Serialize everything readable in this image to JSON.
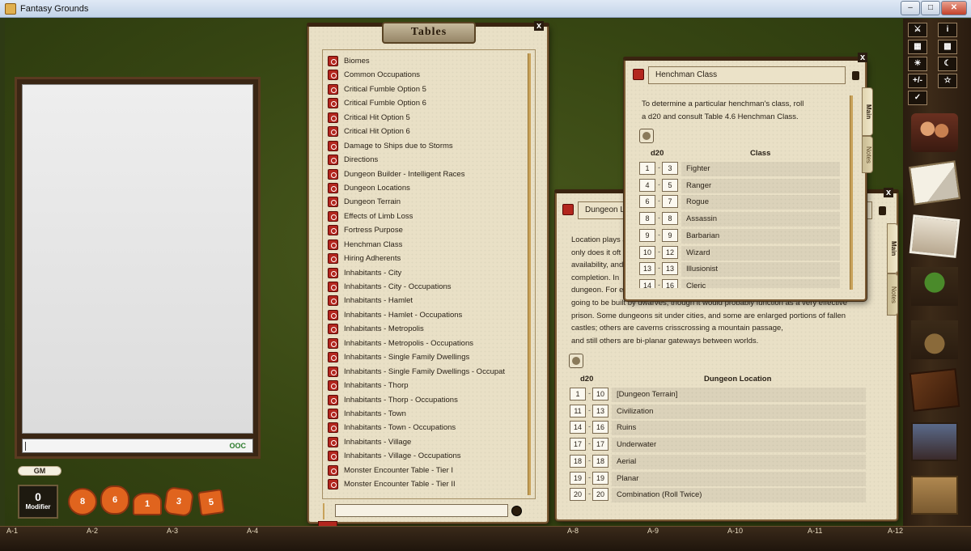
{
  "window": {
    "title": "Fantasy Grounds"
  },
  "chat": {
    "entry_value": "",
    "ooc_label": "OOC"
  },
  "identity": {
    "gm_label": "GM"
  },
  "modifier": {
    "value": "0",
    "label": "Modifier"
  },
  "dice": [
    "d20",
    "d12",
    "d10",
    "d8",
    "d6",
    "d4"
  ],
  "dice_faces": {
    "d20": "8",
    "d12": "6",
    "d10": "1",
    "d8": "3",
    "d6": "5"
  },
  "tables_window": {
    "title": "Tables",
    "close_label": "x",
    "items": [
      "Biomes",
      "Common Occupations",
      "Critical Fumble Option 5",
      "Critical Fumble Option 6",
      "Critical Hit Option 5",
      "Critical Hit Option 6",
      "Damage to Ships due to Storms",
      "Directions",
      "Dungeon Builder - Intelligent Races",
      "Dungeon Locations",
      "Dungeon Terrain",
      "Effects of Limb Loss",
      "Fortress Purpose",
      "Henchman Class",
      "Hiring Adherents",
      "Inhabitants - City",
      "Inhabitants - City - Occupations",
      "Inhabitants - Hamlet",
      "Inhabitants - Hamlet - Occupations",
      "Inhabitants - Metropolis",
      "Inhabitants - Metropolis - Occupations",
      "Inhabitants - Single Family Dwellings",
      "Inhabitants - Single Family Dwellings - Occupat",
      "Inhabitants - Thorp",
      "Inhabitants - Thorp - Occupations",
      "Inhabitants - Town",
      "Inhabitants - Town - Occupations",
      "Inhabitants - Village",
      "Inhabitants - Village - Occupations",
      "Monster Encounter Table - Tier I",
      "Monster Encounter Table - Tier II"
    ],
    "filter_value": ""
  },
  "henchman_window": {
    "name": "Henchman Class",
    "close_label": "x",
    "tabs": [
      "Main",
      "Notes"
    ],
    "description": "To determine a particular henchman's class, roll a d20 and consult Table 4.6 Henchman Class.",
    "col_dice": "d20",
    "col_result": "Class",
    "rows": [
      {
        "from": "1",
        "to": "3",
        "result": "Fighter"
      },
      {
        "from": "4",
        "to": "5",
        "result": "Ranger"
      },
      {
        "from": "6",
        "to": "7",
        "result": "Rogue"
      },
      {
        "from": "8",
        "to": "8",
        "result": "Assassin"
      },
      {
        "from": "9",
        "to": "9",
        "result": "Barbarian"
      },
      {
        "from": "10",
        "to": "12",
        "result": "Wizard"
      },
      {
        "from": "13",
        "to": "13",
        "result": "Illusionist"
      },
      {
        "from": "14",
        "to": "16",
        "result": "Cleric"
      }
    ]
  },
  "dungeon_window": {
    "name": "Dungeon Lo",
    "close_label": "x",
    "tabs": [
      "Main",
      "Notes"
    ],
    "desc_lines": [
      "Location plays a",
      "only does it oft",
      "availability, and",
      "completion. In",
      "dungeon. For e",
      "going to be built by dwarves, though it would probably function as a very effective",
      "prison. Some dungeons sit under cities, and some are enlarged portions of fallen",
      "castles; others are caverns crisscrossing a mountain passage,",
      "and still others are bi-planar gateways between worlds."
    ],
    "col_dice": "d20",
    "col_result": "Dungeon Location",
    "rows": [
      {
        "from": "1",
        "to": "10",
        "result": "[Dungeon Terrain]"
      },
      {
        "from": "11",
        "to": "13",
        "result": "Civilization"
      },
      {
        "from": "14",
        "to": "16",
        "result": "Ruins"
      },
      {
        "from": "17",
        "to": "17",
        "result": "Underwater"
      },
      {
        "from": "18",
        "to": "18",
        "result": "Aerial"
      },
      {
        "from": "19",
        "to": "19",
        "result": "Planar"
      },
      {
        "from": "20",
        "to": "20",
        "result": "Combination (Roll Twice)"
      }
    ]
  },
  "toolbar": {
    "plus_minus": "+/-"
  },
  "sidebar": [
    "characters",
    "story",
    "images",
    "npcs",
    "items",
    "notes",
    "library",
    "tokens"
  ],
  "hotkeys": [
    "A-1",
    "A-2",
    "A-3",
    "A-4",
    "A-8",
    "A-9",
    "A-10",
    "A-11",
    "A-12"
  ]
}
